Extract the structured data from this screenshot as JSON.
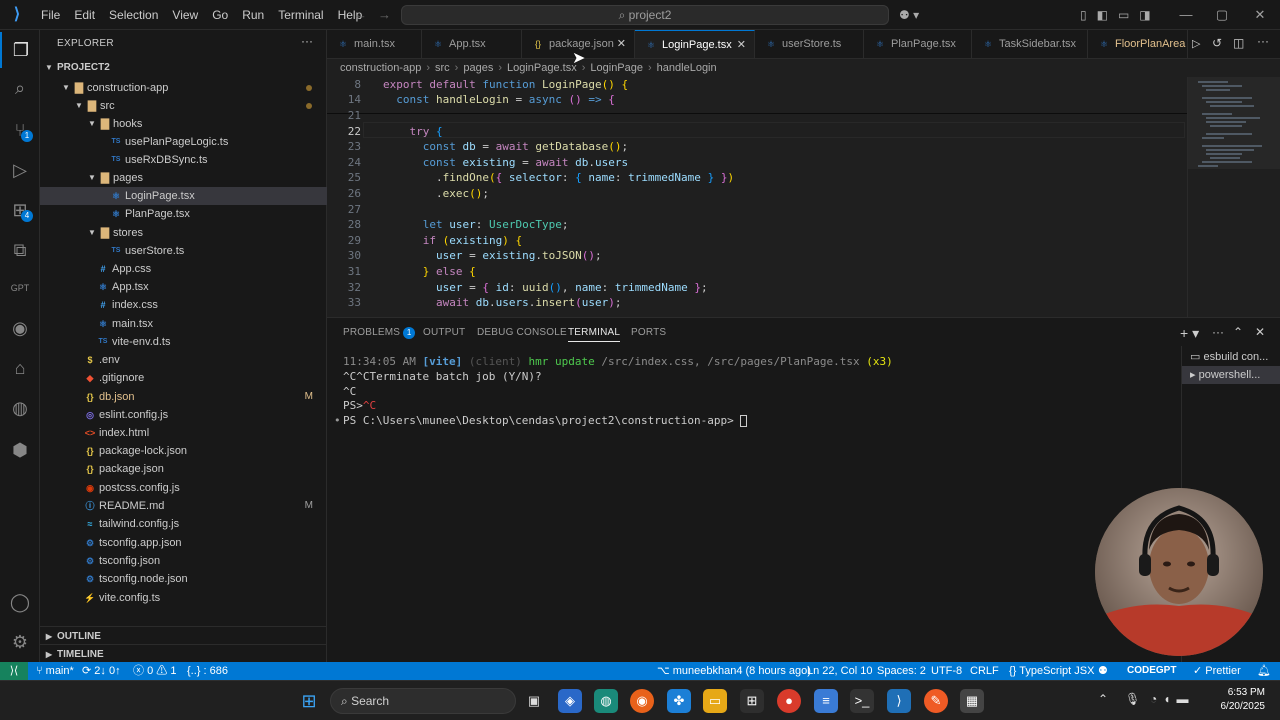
{
  "titlebar": {
    "menus": [
      "File",
      "Edit",
      "Selection",
      "View",
      "Go",
      "Run",
      "Terminal",
      "Help"
    ],
    "search": "project2"
  },
  "sidebar": {
    "header": "EXPLORER",
    "project": "PROJECT2",
    "tree": [
      {
        "label": "construction-app",
        "depth": 1,
        "type": "folder-open",
        "dot": true
      },
      {
        "label": "src",
        "depth": 2,
        "type": "folder-open",
        "dot": true
      },
      {
        "label": "hooks",
        "depth": 3,
        "type": "folder-open"
      },
      {
        "label": "usePlanPageLogic.ts",
        "depth": 4,
        "type": "ts"
      },
      {
        "label": "useRxDBSync.ts",
        "depth": 4,
        "type": "ts"
      },
      {
        "label": "pages",
        "depth": 3,
        "type": "folder-open"
      },
      {
        "label": "LoginPage.tsx",
        "depth": 4,
        "type": "tsx",
        "selected": true
      },
      {
        "label": "PlanPage.tsx",
        "depth": 4,
        "type": "tsx"
      },
      {
        "label": "stores",
        "depth": 3,
        "type": "folder-open"
      },
      {
        "label": "userStore.ts",
        "depth": 4,
        "type": "ts"
      },
      {
        "label": "App.css",
        "depth": 3,
        "type": "css"
      },
      {
        "label": "App.tsx",
        "depth": 3,
        "type": "tsx"
      },
      {
        "label": "index.css",
        "depth": 3,
        "type": "css"
      },
      {
        "label": "main.tsx",
        "depth": 3,
        "type": "tsx"
      },
      {
        "label": "vite-env.d.ts",
        "depth": 3,
        "type": "ts"
      },
      {
        "label": ".env",
        "depth": 2,
        "type": "env"
      },
      {
        "label": ".gitignore",
        "depth": 2,
        "type": "git"
      },
      {
        "label": "db.json",
        "depth": 2,
        "type": "json",
        "status": "M",
        "modified": true
      },
      {
        "label": "eslint.config.js",
        "depth": 2,
        "type": "eslint"
      },
      {
        "label": "index.html",
        "depth": 2,
        "type": "html"
      },
      {
        "label": "package-lock.json",
        "depth": 2,
        "type": "json"
      },
      {
        "label": "package.json",
        "depth": 2,
        "type": "json"
      },
      {
        "label": "postcss.config.js",
        "depth": 2,
        "type": "postcss"
      },
      {
        "label": "README.md",
        "depth": 2,
        "type": "md",
        "status": "M"
      },
      {
        "label": "tailwind.config.js",
        "depth": 2,
        "type": "tailwind"
      },
      {
        "label": "tsconfig.app.json",
        "depth": 2,
        "type": "tsconfig"
      },
      {
        "label": "tsconfig.json",
        "depth": 2,
        "type": "tsconfig"
      },
      {
        "label": "tsconfig.node.json",
        "depth": 2,
        "type": "tsconfig"
      },
      {
        "label": "vite.config.ts",
        "depth": 2,
        "type": "vite"
      }
    ],
    "outline": "OUTLINE",
    "timeline": "TIMELINE"
  },
  "tabs": [
    {
      "label": "main.tsx",
      "type": "tsx"
    },
    {
      "label": "App.tsx",
      "type": "tsx"
    },
    {
      "label": "package.json",
      "type": "json",
      "close": true
    },
    {
      "label": "LoginPage.tsx",
      "type": "tsx",
      "active": true,
      "close": true
    },
    {
      "label": "userStore.ts",
      "type": "ts"
    },
    {
      "label": "PlanPage.tsx",
      "type": "tsx"
    },
    {
      "label": "TaskSidebar.tsx",
      "type": "tsx"
    },
    {
      "label": "FloorPlanArea",
      "type": "tsx",
      "modified": true
    }
  ],
  "breadcrumb": [
    "construction-app",
    "src",
    "pages",
    "LoginPage.tsx",
    "LoginPage",
    "handleLogin"
  ],
  "editor": {
    "current_line": "22",
    "lines": [
      {
        "n": "8",
        "html": "<span class='ctl'>export</span> <span class='ctl'>default</span> <span class='kw'>function</span> <span class='fn'>LoginPage</span><span class='pn'>()</span> <span class='pn'>{</span>"
      },
      {
        "n": "14",
        "html": "  <span class='kw'>const</span> <span class='fn'>handleLogin</span> = <span class='kw'>async</span> <span class='pn2'>()</span> <span class='kw'>=&gt;</span> <span class='pn2'>{</span>"
      },
      {
        "n": "21",
        "html": ""
      },
      {
        "n": "22",
        "html": "    <span class='ctl'>try</span> <span class='pn3'>{</span>"
      },
      {
        "n": "23",
        "html": "      <span class='kw'>const</span> <span class='var'>db</span> = <span class='ctl'>await</span> <span class='fn'>getDatabase</span><span class='pn'>()</span>;"
      },
      {
        "n": "24",
        "html": "      <span class='kw'>const</span> <span class='var'>existing</span> = <span class='ctl'>await</span> <span class='var'>db</span>.<span class='var'>users</span>"
      },
      {
        "n": "25",
        "html": "        .<span class='fn'>findOne</span><span class='pn'>(</span><span class='pn2'>{</span> <span class='var'>selector</span>: <span class='pn3'>{</span> <span class='var'>name</span>: <span class='var'>trimmedName</span> <span class='pn3'>}</span> <span class='pn2'>}</span><span class='pn'>)</span>"
      },
      {
        "n": "26",
        "html": "        .<span class='fn'>exec</span><span class='pn'>()</span>;"
      },
      {
        "n": "27",
        "html": ""
      },
      {
        "n": "28",
        "html": "      <span class='kw'>let</span> <span class='var'>user</span>: <span class='ty'>UserDocType</span>;"
      },
      {
        "n": "29",
        "html": "      <span class='ctl'>if</span> <span class='pn'>(</span><span class='var'>existing</span><span class='pn'>)</span> <span class='pn'>{</span>"
      },
      {
        "n": "30",
        "html": "        <span class='var'>user</span> = <span class='var'>existing</span>.<span class='fn'>toJSON</span><span class='pn2'>()</span>;"
      },
      {
        "n": "31",
        "html": "      <span class='pn'>}</span> <span class='ctl'>else</span> <span class='pn'>{</span>"
      },
      {
        "n": "32",
        "html": "        <span class='var'>user</span> = <span class='pn2'>{</span> <span class='var'>id</span>: <span class='fn'>uuid</span><span class='pn3'>()</span>, <span class='var'>name</span>: <span class='var'>trimmedName</span> <span class='pn2'>}</span>;"
      },
      {
        "n": "33",
        "html": "        <span class='ctl'>await</span> <span class='var'>db</span>.<span class='var'>users</span>.<span class='fn'>insert</span><span class='pn2'>(</span><span class='var'>user</span><span class='pn2'>)</span>;"
      }
    ]
  },
  "panel": {
    "tabs": [
      "PROBLEMS",
      "OUTPUT",
      "DEBUG CONSOLE",
      "TERMINAL",
      "PORTS"
    ],
    "problems_count": "1",
    "active": "TERMINAL",
    "terminal_lines": [
      "<span style='color:#8b8b8b'>11:34:05 AM</span> <span style='color:#569cd6;font-weight:bold'>[vite]</span> <span style='color:#555'>(client)</span> <span style='color:#4ec94e'>hmr update</span> <span style='color:#8b8b8b'>/src/index.css, /src/pages/PlanPage.tsx</span> <span style='color:#e5e510'>(x3)</span>",
      "^C^CTerminate batch job (Y/N)?",
      "^C",
      "PS&gt;<span style='color:#e04040'>^C</span>",
      "PS C:\\Users\\munee\\Desktop\\cendas\\project2\\construction-app&gt; "
    ],
    "terminals": [
      "esbuild con...",
      "powershell..."
    ]
  },
  "statusbar": {
    "branch": "main*",
    "sync": "2↓ 0↑",
    "errors": "0",
    "warnings": "1",
    "selection": "{..} : 686",
    "blame": "muneebkhan4 (8 hours ago)",
    "position": "Ln 22, Col 10",
    "spaces": "Spaces: 2",
    "encoding": "UTF-8",
    "eol": "CRLF",
    "language": "TypeScript JSX",
    "codegpt": "CODEGPT",
    "prettier": "Prettier"
  },
  "taskbar": {
    "search": "Search",
    "time": "6:53 PM",
    "date": "6/20/2025"
  },
  "colors": {
    "accent": "#0078d4",
    "statusbar": "#0078d4",
    "editor_bg": "#1f1f1f",
    "sidebar_bg": "#181818"
  }
}
